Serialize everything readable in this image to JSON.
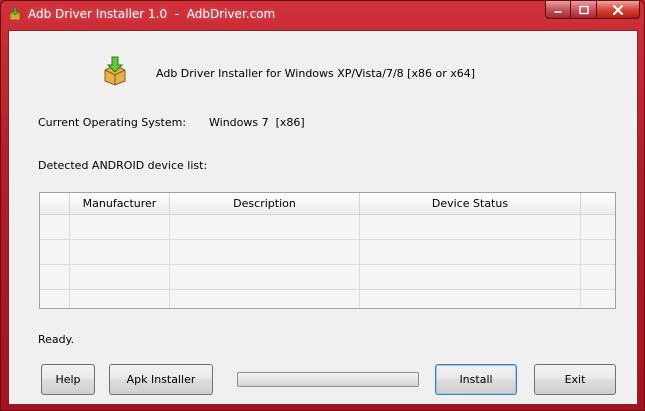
{
  "window": {
    "title": "Adb Driver Installer 1.0  -  AdbDriver.com",
    "icon": "installer-box-icon"
  },
  "caption_buttons": {
    "minimize_icon": "minimize-icon",
    "maximize_icon": "maximize-icon",
    "close_icon": "close-icon"
  },
  "header": {
    "icon": "installer-box-icon",
    "text": "Adb Driver Installer for Windows XP/Vista/7/8 [x86 or x64]"
  },
  "system": {
    "label": "Current Operating System:",
    "value": "Windows 7  [x86]"
  },
  "device_list": {
    "label": "Detected ANDROID device list:",
    "columns": [
      "Manufacturer",
      "Description",
      "Device Status"
    ],
    "rows": []
  },
  "status": "Ready.",
  "progress": {
    "value_fraction": 0
  },
  "buttons": {
    "help": "Help",
    "apk_installer": "Apk Installer",
    "install": "Install",
    "exit": "Exit"
  },
  "colors": {
    "title_bar": "#b8202b",
    "client_bg": "#f0f0f0",
    "default_button_border": "#3c7fb1"
  }
}
